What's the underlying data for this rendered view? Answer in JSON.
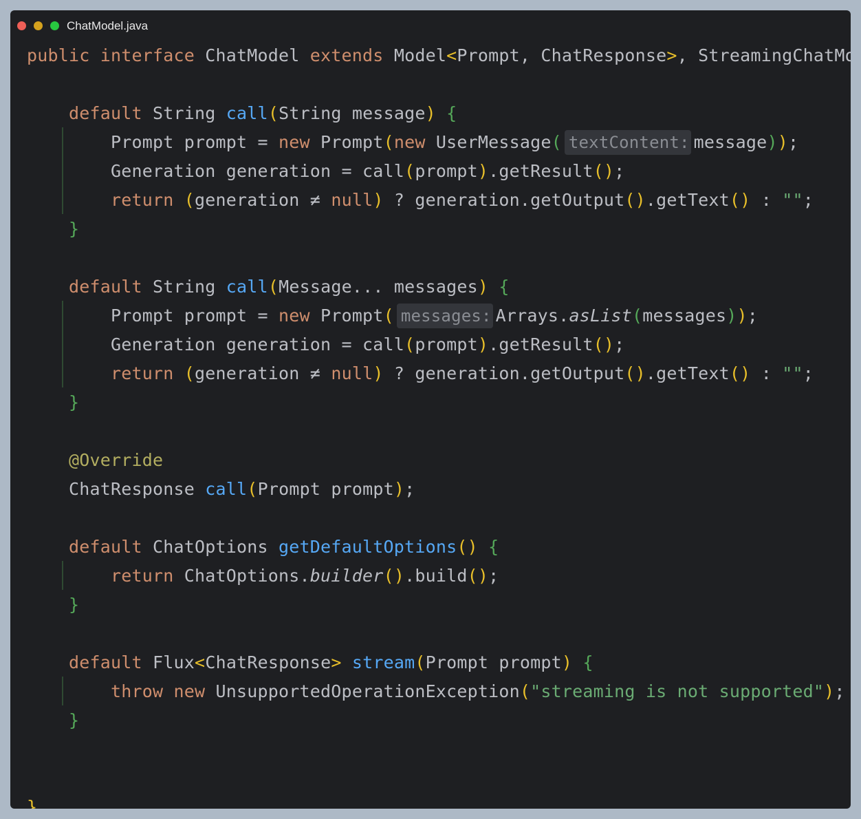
{
  "window": {
    "title": "ChatModel.java",
    "traffic_lights": {
      "close": "#ee5f57",
      "minimize": "#d5a21e",
      "maximize": "#28c840"
    }
  },
  "theme": {
    "keyword": "#cf8e6d",
    "plain": "#bcbec4",
    "method": "#56a8f5",
    "annotation": "#b3ae60",
    "string": "#6aab73",
    "brace_outer": "#e8bf2a",
    "brace_inner": "#55a859",
    "paren": "#e8bf2a"
  },
  "code_lines": [
    [
      [
        "public ",
        "keyword"
      ],
      [
        "interface ",
        "keyword"
      ],
      [
        "ChatModel ",
        "plain"
      ],
      [
        "extends ",
        "keyword"
      ],
      [
        "Model",
        "plain"
      ],
      [
        "<",
        "paren"
      ],
      [
        "Prompt, ChatResponse",
        "plain"
      ],
      [
        ">",
        "paren"
      ],
      [
        ", StreamingChatModel ",
        "plain"
      ],
      [
        "{",
        "brace_outer"
      ]
    ],
    [],
    [
      [
        "    ",
        "plain"
      ],
      [
        "default ",
        "keyword"
      ],
      [
        "String ",
        "plain"
      ],
      [
        "call",
        "method"
      ],
      [
        "(",
        "paren"
      ],
      [
        "String message",
        "plain"
      ],
      [
        ")",
        "paren"
      ],
      [
        " ",
        "plain"
      ],
      [
        "{",
        "brace_inner"
      ]
    ],
    [
      [
        "        Prompt prompt = ",
        "plain"
      ],
      [
        "new ",
        "keyword"
      ],
      [
        "Prompt",
        "plain"
      ],
      [
        "(",
        "paren"
      ],
      [
        "new ",
        "keyword"
      ],
      [
        "UserMessage",
        "plain"
      ],
      [
        "(",
        "brace_inner"
      ],
      [
        "textContent:",
        "hint"
      ],
      [
        "message",
        "plain"
      ],
      [
        ")",
        "brace_inner"
      ],
      [
        ")",
        "paren"
      ],
      [
        ";",
        "plain"
      ]
    ],
    [
      [
        "        Generation generation = call",
        "plain"
      ],
      [
        "(",
        "paren"
      ],
      [
        "prompt",
        "plain"
      ],
      [
        ")",
        "paren"
      ],
      [
        ".getResult",
        "plain"
      ],
      [
        "()",
        "paren"
      ],
      [
        ";",
        "plain"
      ]
    ],
    [
      [
        "        ",
        "plain"
      ],
      [
        "return ",
        "keyword"
      ],
      [
        "(",
        "paren"
      ],
      [
        "generation ≠ ",
        "plain"
      ],
      [
        "null",
        "keyword"
      ],
      [
        ")",
        "paren"
      ],
      [
        " ? generation.getOutput",
        "plain"
      ],
      [
        "()",
        "paren"
      ],
      [
        ".getText",
        "plain"
      ],
      [
        "()",
        "paren"
      ],
      [
        " : ",
        "plain"
      ],
      [
        "\"\"",
        "string"
      ],
      [
        ";",
        "plain"
      ]
    ],
    [
      [
        "    ",
        "plain"
      ],
      [
        "}",
        "brace_inner"
      ]
    ],
    [],
    [
      [
        "    ",
        "plain"
      ],
      [
        "default ",
        "keyword"
      ],
      [
        "String ",
        "plain"
      ],
      [
        "call",
        "method"
      ],
      [
        "(",
        "paren"
      ],
      [
        "Message... messages",
        "plain"
      ],
      [
        ")",
        "paren"
      ],
      [
        " ",
        "plain"
      ],
      [
        "{",
        "brace_inner"
      ]
    ],
    [
      [
        "        Prompt prompt = ",
        "plain"
      ],
      [
        "new ",
        "keyword"
      ],
      [
        "Prompt",
        "plain"
      ],
      [
        "(",
        "paren"
      ],
      [
        "messages:",
        "hint"
      ],
      [
        "Arrays.",
        "plain"
      ],
      [
        "asList",
        "italic"
      ],
      [
        "(",
        "brace_inner"
      ],
      [
        "messages",
        "plain"
      ],
      [
        ")",
        "brace_inner"
      ],
      [
        ")",
        "paren"
      ],
      [
        ";",
        "plain"
      ]
    ],
    [
      [
        "        Generation generation = call",
        "plain"
      ],
      [
        "(",
        "paren"
      ],
      [
        "prompt",
        "plain"
      ],
      [
        ")",
        "paren"
      ],
      [
        ".getResult",
        "plain"
      ],
      [
        "()",
        "paren"
      ],
      [
        ";",
        "plain"
      ]
    ],
    [
      [
        "        ",
        "plain"
      ],
      [
        "return ",
        "keyword"
      ],
      [
        "(",
        "paren"
      ],
      [
        "generation ≠ ",
        "plain"
      ],
      [
        "null",
        "keyword"
      ],
      [
        ")",
        "paren"
      ],
      [
        " ? generation.getOutput",
        "plain"
      ],
      [
        "()",
        "paren"
      ],
      [
        ".getText",
        "plain"
      ],
      [
        "()",
        "paren"
      ],
      [
        " : ",
        "plain"
      ],
      [
        "\"\"",
        "string"
      ],
      [
        ";",
        "plain"
      ]
    ],
    [
      [
        "    ",
        "plain"
      ],
      [
        "}",
        "brace_inner"
      ]
    ],
    [],
    [
      [
        "    ",
        "plain"
      ],
      [
        "@Override",
        "annotation"
      ]
    ],
    [
      [
        "    ChatResponse ",
        "plain"
      ],
      [
        "call",
        "method"
      ],
      [
        "(",
        "paren"
      ],
      [
        "Prompt prompt",
        "plain"
      ],
      [
        ")",
        "paren"
      ],
      [
        ";",
        "plain"
      ]
    ],
    [],
    [
      [
        "    ",
        "plain"
      ],
      [
        "default ",
        "keyword"
      ],
      [
        "ChatOptions ",
        "plain"
      ],
      [
        "getDefaultOptions",
        "method"
      ],
      [
        "()",
        "paren"
      ],
      [
        " ",
        "plain"
      ],
      [
        "{",
        "brace_inner"
      ]
    ],
    [
      [
        "        ",
        "plain"
      ],
      [
        "return ",
        "keyword"
      ],
      [
        "ChatOptions.",
        "plain"
      ],
      [
        "builder",
        "italic"
      ],
      [
        "()",
        "paren"
      ],
      [
        ".build",
        "plain"
      ],
      [
        "()",
        "paren"
      ],
      [
        ";",
        "plain"
      ]
    ],
    [
      [
        "    ",
        "plain"
      ],
      [
        "}",
        "brace_inner"
      ]
    ],
    [],
    [
      [
        "    ",
        "plain"
      ],
      [
        "default ",
        "keyword"
      ],
      [
        "Flux",
        "plain"
      ],
      [
        "<",
        "paren"
      ],
      [
        "ChatResponse",
        "plain"
      ],
      [
        ">",
        "paren"
      ],
      [
        " ",
        "plain"
      ],
      [
        "stream",
        "method"
      ],
      [
        "(",
        "paren"
      ],
      [
        "Prompt prompt",
        "plain"
      ],
      [
        ")",
        "paren"
      ],
      [
        " ",
        "plain"
      ],
      [
        "{",
        "brace_inner"
      ]
    ],
    [
      [
        "        ",
        "plain"
      ],
      [
        "throw ",
        "keyword"
      ],
      [
        "new ",
        "keyword"
      ],
      [
        "UnsupportedOperationException",
        "plain"
      ],
      [
        "(",
        "paren"
      ],
      [
        "\"streaming is not supported\"",
        "string"
      ],
      [
        ")",
        "paren"
      ],
      [
        ";",
        "plain"
      ]
    ],
    [
      [
        "    ",
        "plain"
      ],
      [
        "}",
        "brace_inner"
      ]
    ],
    [],
    [],
    [
      [
        "}",
        "brace_outer"
      ]
    ]
  ]
}
